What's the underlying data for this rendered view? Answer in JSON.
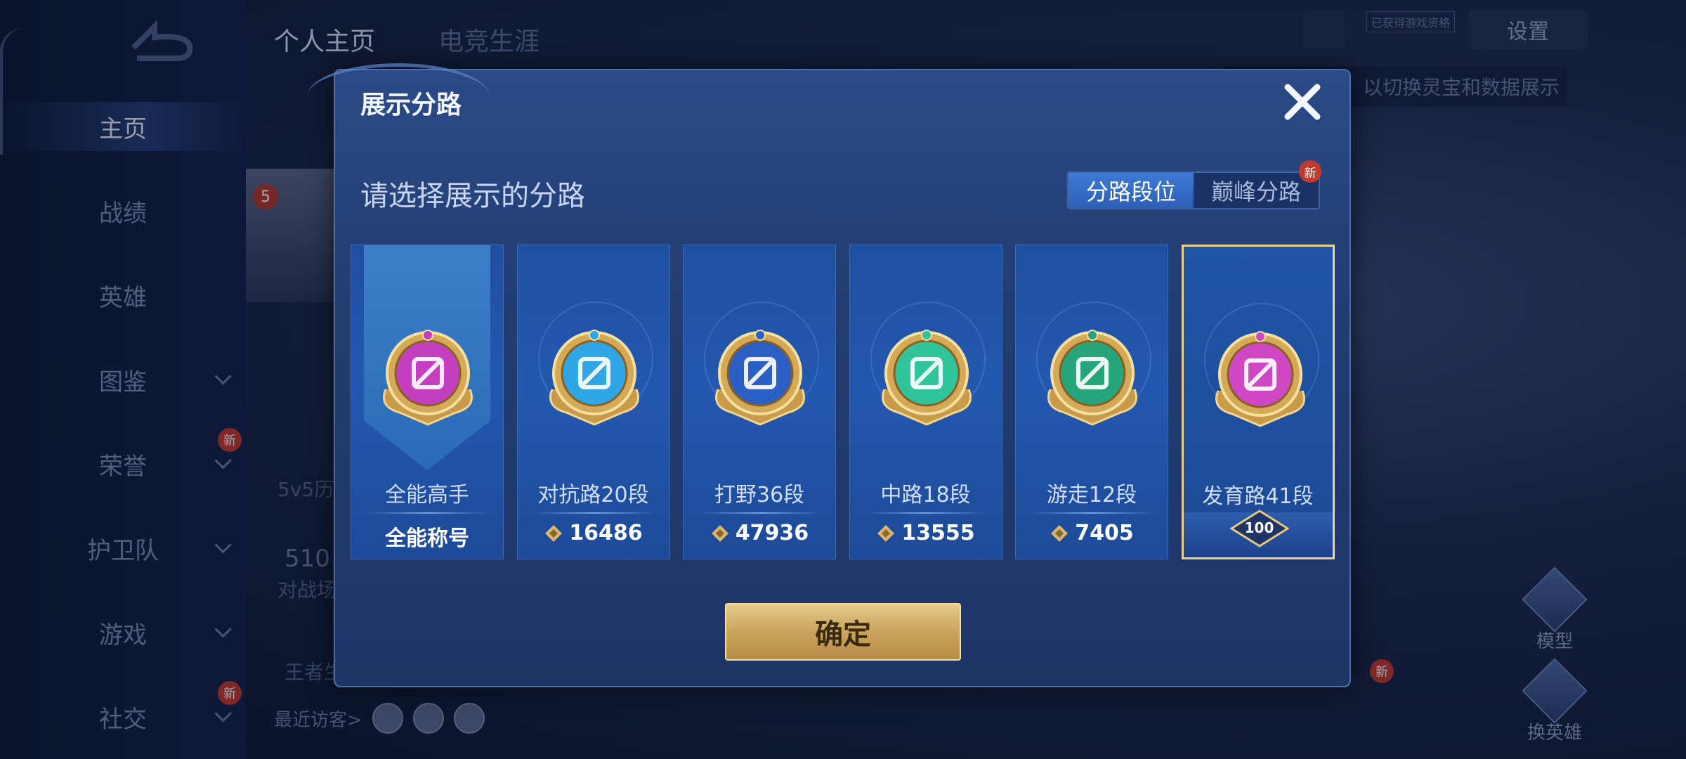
{
  "nav": {
    "items": [
      {
        "label": "主页",
        "active": true
      },
      {
        "label": "战绩"
      },
      {
        "label": "英雄"
      },
      {
        "label": "图鉴",
        "chevron": true
      },
      {
        "label": "荣誉",
        "chevron": true,
        "new": "新"
      },
      {
        "label": "护卫队",
        "chevron": true
      },
      {
        "label": "游戏",
        "chevron": true
      },
      {
        "label": "社交",
        "chevron": true,
        "new": "新"
      }
    ]
  },
  "top_tabs": [
    "个人主页",
    "电竞生涯"
  ],
  "background": {
    "level_badge": "5",
    "history_label": "5v5历",
    "match_count": "510",
    "match_label": "对战场",
    "king_label": "王者生",
    "visitors_label": "最近访客>",
    "settings": "设置",
    "mini_tip": "已获得游戏资格",
    "hint": "以切换灵宝和数据展示",
    "model_label": "模型",
    "change_hero_label": "换英雄",
    "new_tag": "新"
  },
  "dialog": {
    "title": "展示分路",
    "subtitle": "请选择展示的分路",
    "toggle": {
      "options": [
        "分路段位",
        "巅峰分路"
      ],
      "selected": 0,
      "new_tag": "新"
    },
    "confirm": "确定"
  },
  "cards": [
    {
      "name": "全能高手",
      "value": "全能称号",
      "emblem": "allround-emblem-icon",
      "color": "#c43fc0",
      "banner": true
    },
    {
      "name": "对抗路20段",
      "value": "16486",
      "emblem": "sword-emblem-icon",
      "color": "#2fa6e6"
    },
    {
      "name": "打野36段",
      "value": "47936",
      "emblem": "dragon-emblem-icon",
      "color": "#2a5fc4"
    },
    {
      "name": "中路18段",
      "value": "13555",
      "emblem": "mid-emblem-icon",
      "color": "#2fc49a"
    },
    {
      "name": "游走12段",
      "value": "7405",
      "emblem": "wings-emblem-icon",
      "color": "#26a57c"
    },
    {
      "name": "发育路41段",
      "value": "100",
      "emblem": "marksman-emblem-icon",
      "color": "#d047c4",
      "selected": true
    }
  ]
}
